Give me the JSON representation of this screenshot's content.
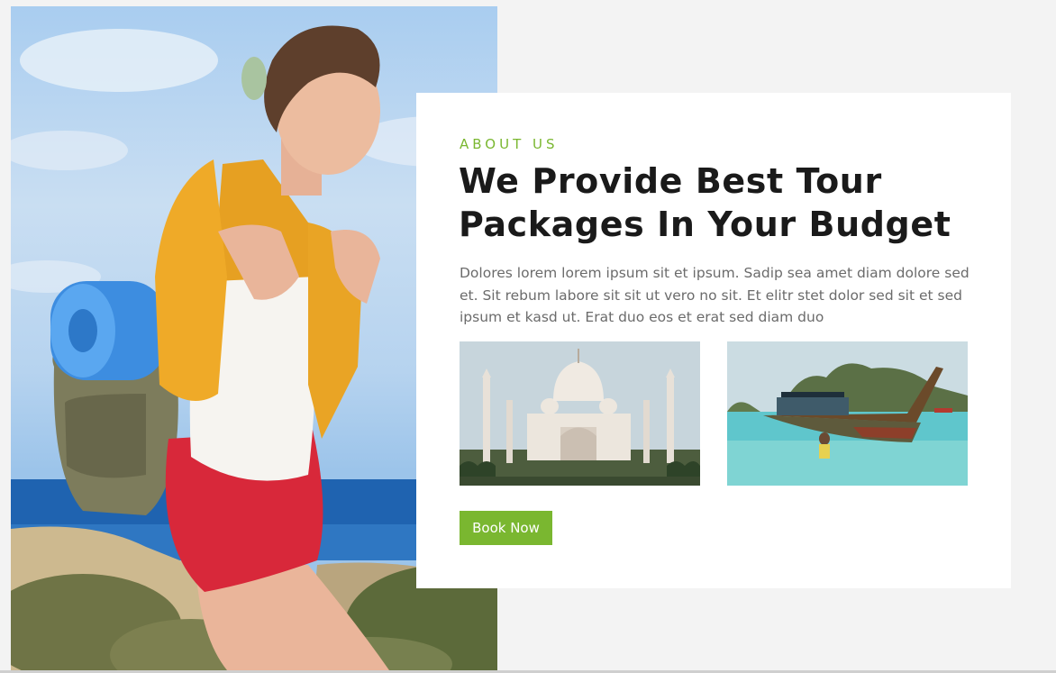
{
  "about": {
    "eyebrow": "ABOUT US",
    "heading_line1": "We Provide Best Tour",
    "heading_line2": "Packages In Your Budget",
    "body": "Dolores lorem lorem ipsum sit et ipsum. Sadip sea amet diam dolore sed et. Sit rebum labore sit sit ut vero no sit. Et elitr stet dolor sed sit et sed ipsum et kasd ut. Erat duo eos et erat sed diam duo",
    "cta_label": "Book Now"
  },
  "colors": {
    "accent": "#7ab730",
    "heading": "#1a1a1a",
    "body_text": "#6b6b6b",
    "card_background": "#ffffff",
    "page_background": "#f3f3f3"
  }
}
